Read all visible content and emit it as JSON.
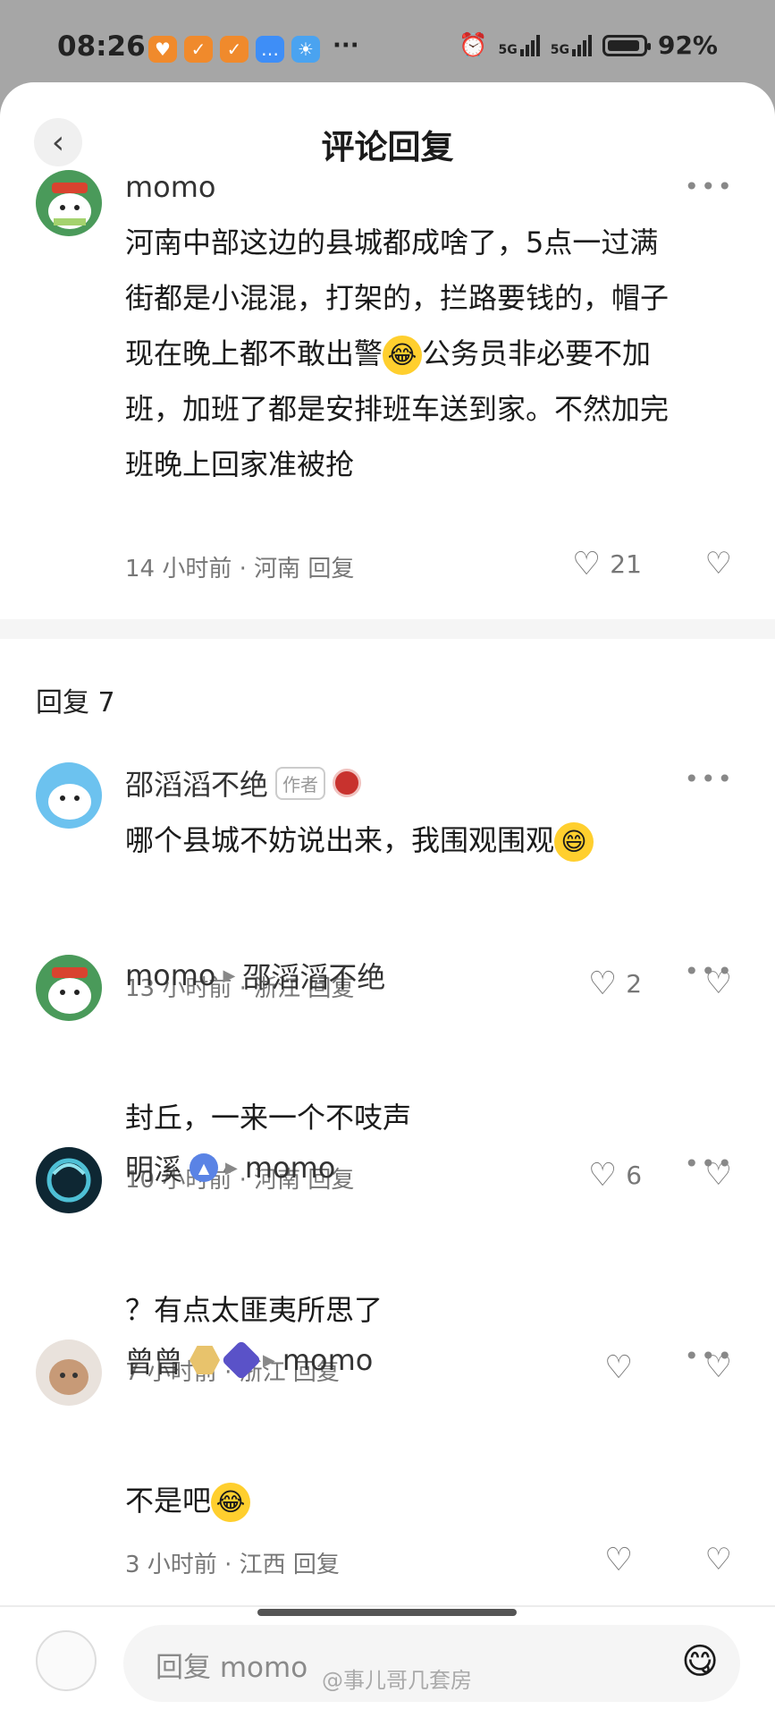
{
  "status_bar": {
    "time": "08:26",
    "network1": "5G",
    "network2": "5G",
    "battery": "92%",
    "battery_level": 0.92
  },
  "header": {
    "title": "评论回复"
  },
  "main_comment": {
    "username": "momo",
    "lines": [
      "河南中部这边的县城都成啥了，5点一过满",
      "街都是小混混，打架的，拦路要钱的，帽子",
      "现在晚上都不敢出警",
      "公务员非必要不加",
      "班，加班了都是安排班车送到家。不然加完",
      "班晚上回家准被抢"
    ],
    "meta": "14 小时前 · 河南 回复",
    "likes": "21"
  },
  "replies_header": "回复 7",
  "replies": [
    {
      "username": "邵滔滔不绝",
      "author_tag": "作者",
      "text": "哪个县城不妨说出来，我围观围观",
      "meta": "13 小时前 · 浙江 回复",
      "likes": "2"
    },
    {
      "username": "momo",
      "reply_to": "邵滔滔不绝",
      "text": "封丘，一来一个不吱声",
      "meta": "10 小时前 · 河南 回复",
      "likes": "6"
    },
    {
      "username": "明溪",
      "reply_to": "momo",
      "text": "？有点太匪夷所思了",
      "meta": "7 小时前 · 浙江 回复",
      "likes": ""
    },
    {
      "username": "曾曾",
      "reply_to": "momo",
      "text": "不是吧",
      "meta": "3 小时前 · 江西 回复",
      "likes": ""
    }
  ],
  "composer": {
    "placeholder": "回复 momo"
  },
  "watermark": "@事儿哥几套房"
}
